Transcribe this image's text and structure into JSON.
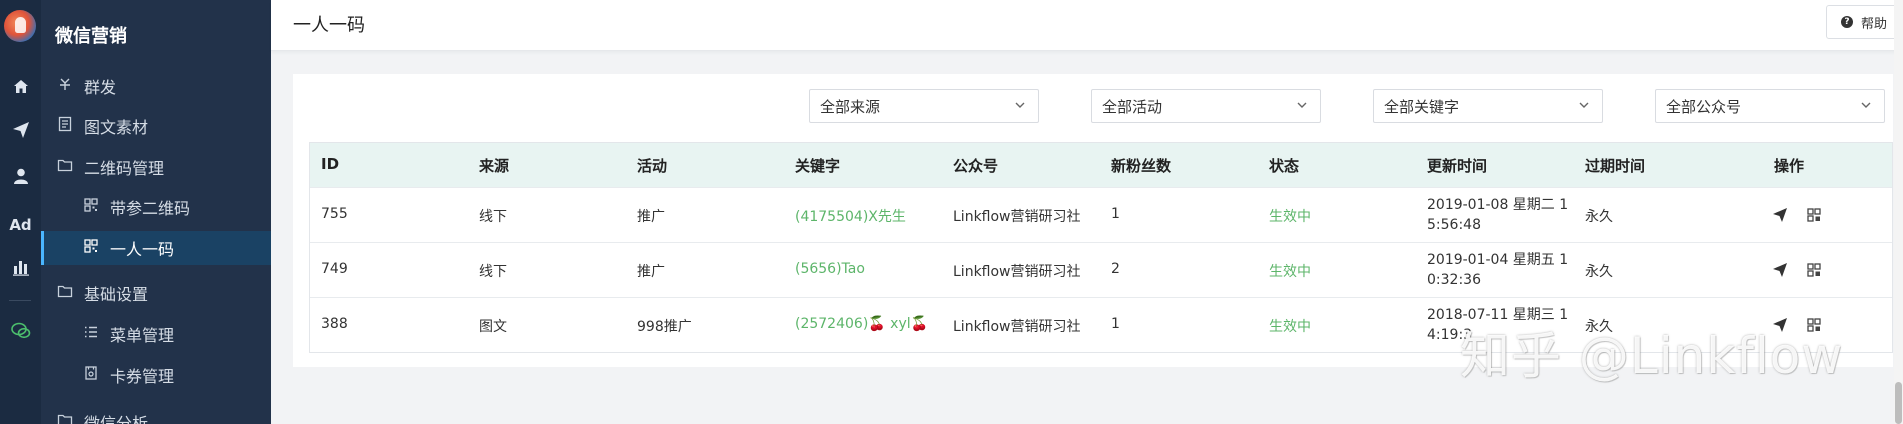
{
  "sidebar": {
    "title": "微信营销",
    "items": [
      {
        "label": "群发",
        "icon": "broadcast-icon"
      },
      {
        "label": "图文素材",
        "icon": "document-icon"
      },
      {
        "label": "二维码管理",
        "icon": "folder-icon"
      },
      {
        "label": "带参二维码",
        "icon": "qrcode-icon"
      },
      {
        "label": "一人一码",
        "icon": "qrcode-icon"
      },
      {
        "label": "基础设置",
        "icon": "folder-icon"
      },
      {
        "label": "菜单管理",
        "icon": "list-icon"
      },
      {
        "label": "卡券管理",
        "icon": "coupon-icon"
      },
      {
        "label": "微信分析",
        "icon": "folder-icon"
      }
    ]
  },
  "rail": {
    "icons": [
      "home-icon",
      "send-icon",
      "user-icon",
      "ad-label",
      "chart-icon",
      "wechat-icon"
    ],
    "ad_label": "Ad"
  },
  "header": {
    "title": "一人一码",
    "help_label": "帮助"
  },
  "filters": {
    "source": "全部来源",
    "activity": "全部活动",
    "keyword": "全部关键字",
    "account": "全部公众号"
  },
  "table": {
    "columns": [
      "ID",
      "来源",
      "活动",
      "关键字",
      "公众号",
      "新粉丝数",
      "状态",
      "更新时间",
      "过期时间",
      "操作"
    ],
    "rows": [
      {
        "id": "755",
        "source": "线下",
        "activity": "推广",
        "keyword": "(4175504)X先生",
        "account": "Linkflow营销研习社",
        "new_fans": "1",
        "status": "生效中",
        "updated_line1": "2019-01-08 星期二 1",
        "updated_line2": "5:56:48",
        "expire": "永久"
      },
      {
        "id": "749",
        "source": "线下",
        "activity": "推广",
        "keyword": "(5656)Tao",
        "account": "Linkflow营销研习社",
        "new_fans": "2",
        "status": "生效中",
        "updated_line1": "2019-01-04 星期五 1",
        "updated_line2": "0:32:36",
        "expire": "永久"
      },
      {
        "id": "388",
        "source": "图文",
        "activity": "998推广",
        "keyword": "(2572406)🍒 xyl🍒",
        "account": "Linkflow营销研习社",
        "new_fans": "1",
        "status": "生效中",
        "updated_line1": "2018-07-11 星期三 1",
        "updated_line2": "4:19:3",
        "expire": "永久"
      }
    ]
  },
  "watermark": "知乎 @Linkflow",
  "colors": {
    "sidebar_bg": "#22324a",
    "rail_bg": "#1b2b41",
    "active_item_bg": "#1a4264",
    "table_header_bg": "#e8f4f2",
    "status_green": "#5db56a"
  }
}
